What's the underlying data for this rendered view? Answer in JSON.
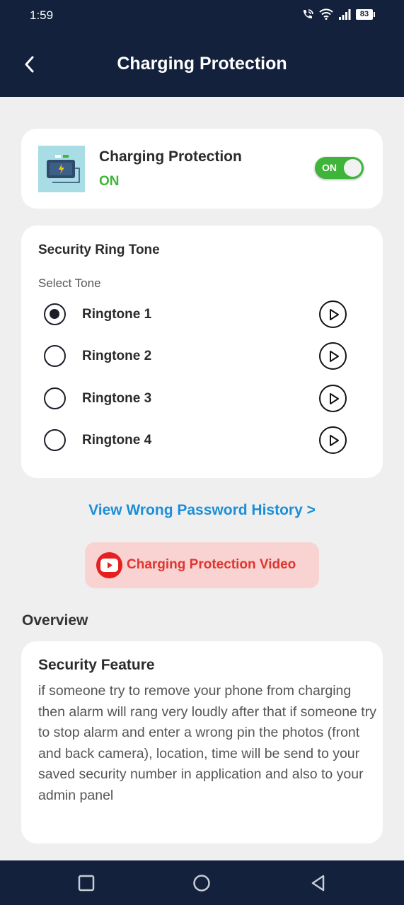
{
  "status_bar": {
    "time": "1:59",
    "battery": "83",
    "icons": [
      "call-wifi-icon",
      "wifi-icon",
      "signal-icon",
      "battery-icon"
    ]
  },
  "app_bar": {
    "title": "Charging Protection",
    "back_icon": "back-arrow-icon"
  },
  "protection_card": {
    "title": "Charging Protection",
    "state": "ON",
    "toggle_label": "ON",
    "toggle_on": true,
    "state_color": "#3fb43a"
  },
  "ringtone_card": {
    "heading": "Security Ring Tone",
    "subheading": "Select Tone",
    "tones": [
      {
        "label": "Ringtone 1",
        "selected": true
      },
      {
        "label": "Ringtone 2",
        "selected": false
      },
      {
        "label": "Ringtone 3",
        "selected": false
      },
      {
        "label": "Ringtone 4",
        "selected": false
      }
    ]
  },
  "history_link": "View Wrong Password History >",
  "video_button": {
    "label": "Charging Protection Video",
    "icon": "youtube-icon"
  },
  "overview": {
    "title": "Overview",
    "card_heading": "Security Feature",
    "card_body": "if someone try to remove your phone from charging then alarm will rang very loudly after that if someone try to stop alarm and enter a wrong pin the photos (front and back camera), location, time will be send to your saved security number in application and also to your admin panel"
  },
  "colors": {
    "header_bg": "#13213d",
    "accent_green": "#3fb43a",
    "link_blue": "#1c8ed8",
    "video_red": "#e0352f"
  },
  "nav_bar": {
    "icons": [
      "recents-square-icon",
      "home-circle-icon",
      "back-triangle-icon"
    ]
  }
}
